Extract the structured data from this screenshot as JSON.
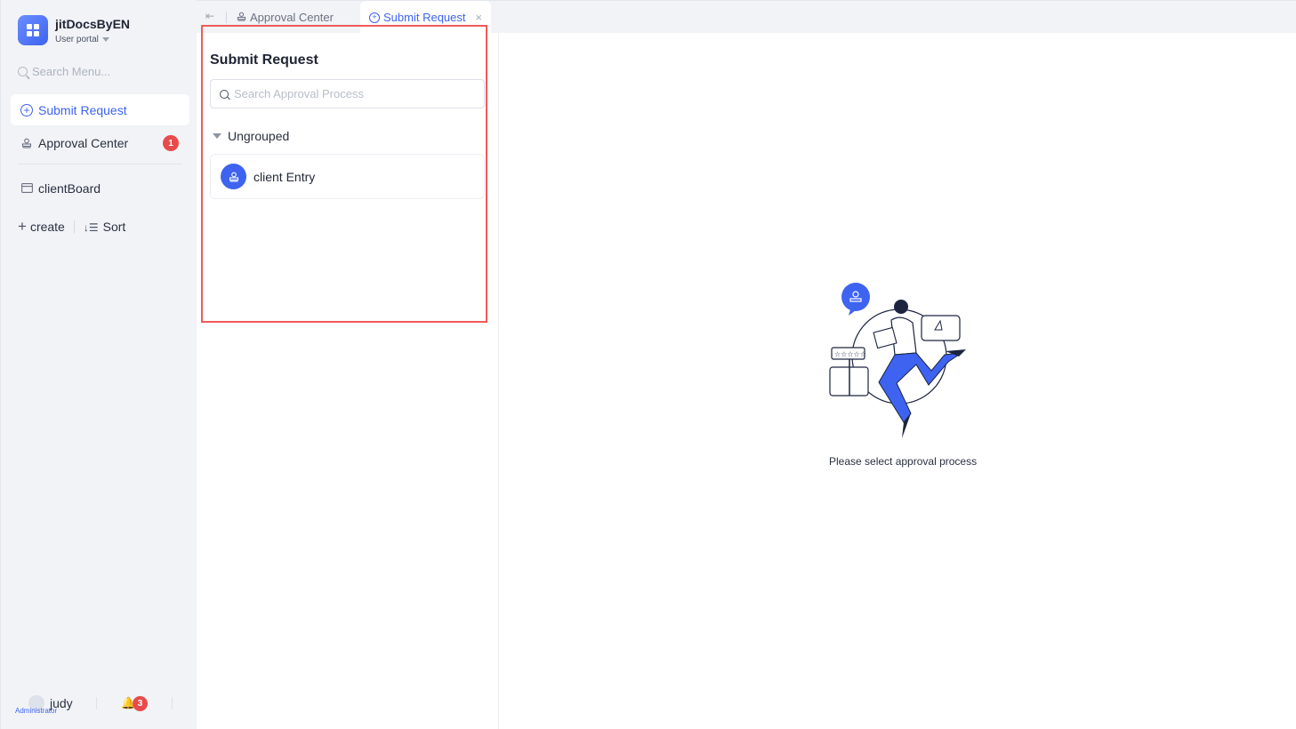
{
  "app": {
    "name": "jitDocsByEN",
    "portal": "User portal"
  },
  "sidebar": {
    "search_placeholder": "Search Menu...",
    "items": [
      {
        "label": "Submit Request",
        "icon": "circle-plus-icon",
        "active": true
      },
      {
        "label": "Approval Center",
        "icon": "stamp-icon",
        "badge": "1"
      },
      {
        "label": "clientBoard",
        "icon": "board-icon"
      }
    ],
    "actions": {
      "create": "create",
      "sort": "Sort"
    },
    "user": {
      "name": "judy",
      "role": "Administrator",
      "notifications": "3"
    }
  },
  "tabs": [
    {
      "label": "Approval Center",
      "icon": "stamp-icon"
    },
    {
      "label": "Submit Request",
      "icon": "circle-plus-icon",
      "active": true
    }
  ],
  "panel": {
    "title": "Submit Request",
    "search_placeholder": "Search Approval Process",
    "group": "Ungrouped",
    "processes": [
      {
        "label": "client Entry",
        "icon": "stamp-icon"
      }
    ]
  },
  "empty_state": {
    "text": "Please select approval process"
  },
  "colors": {
    "accent": "#3e63f0",
    "badge": "#e84b4b",
    "highlight": "#f05a5a"
  }
}
